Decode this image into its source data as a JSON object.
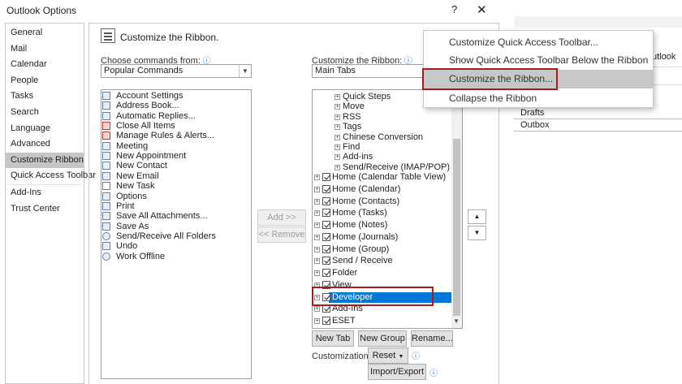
{
  "window": {
    "title": "Outlook Options",
    "help": "?",
    "close": "✕"
  },
  "nav": [
    "General",
    "Mail",
    "Calendar",
    "People",
    "Tasks",
    "Search",
    "Language",
    "Advanced",
    "Customize Ribbon",
    "Quick Access Toolbar",
    "Add-Ins",
    "Trust Center"
  ],
  "header": {
    "title": "Customize the Ribbon."
  },
  "left": {
    "choose_label_pre": "Choose commands from:",
    "combo_value": "Popular Commands",
    "commands": [
      {
        "label": "Account Settings",
        "icon": "account-settings-icon"
      },
      {
        "label": "Address Book...",
        "icon": "address-book-icon"
      },
      {
        "label": "Automatic Replies...",
        "icon": "automatic-replies-icon"
      },
      {
        "label": "Close All Items",
        "icon": "close-items-icon"
      },
      {
        "label": "Manage Rules & Alerts...",
        "icon": "rules-icon"
      },
      {
        "label": "Meeting",
        "icon": "meeting-icon"
      },
      {
        "label": "New Appointment",
        "icon": "calendar-icon"
      },
      {
        "label": "New Contact",
        "icon": "contact-icon"
      },
      {
        "label": "New Email",
        "icon": "mail-icon"
      },
      {
        "label": "New Task",
        "icon": "task-icon"
      },
      {
        "label": "Options",
        "icon": "options-icon"
      },
      {
        "label": "Print",
        "icon": "print-icon"
      },
      {
        "label": "Save All Attachments...",
        "icon": "attachment-icon"
      },
      {
        "label": "Save As",
        "icon": "save-icon"
      },
      {
        "label": "Send/Receive All Folders",
        "icon": "send-receive-icon"
      },
      {
        "label": "Undo",
        "icon": "undo-icon"
      },
      {
        "label": "Work Offline",
        "icon": "offline-icon"
      }
    ]
  },
  "middle": {
    "add": "Add >>",
    "remove": "<< Remove"
  },
  "right": {
    "customize_label": "Customize the Ribbon:",
    "combo_value": "Main Tabs",
    "subgroups": [
      "Quick Steps",
      "Move",
      "RSS",
      "Tags",
      "Chinese Conversion",
      "Find",
      "Add-ins",
      "Send/Receive (IMAP/POP)"
    ],
    "tabs": [
      "Home (Calendar Table View)",
      "Home (Calendar)",
      "Home (Contacts)",
      "Home (Tasks)",
      "Home (Notes)",
      "Home (Journals)",
      "Home (Group)",
      "Send / Receive",
      "Folder",
      "View",
      "Developer",
      "Add-Ins",
      "ESET"
    ],
    "selected_tab": "Developer",
    "new_tab": "New Tab",
    "new_group": "New Group",
    "rename": "Rename...",
    "customizations_label": "Customizations:",
    "reset": "Reset",
    "import_export": "Import/Export"
  },
  "popup": {
    "items": [
      "Customize Quick Access Toolbar...",
      "Show Quick Access Toolbar Below the Ribbon",
      "Customize the Ribbon...",
      "Collapse the Ribbon"
    ],
    "highlighted": "Customize the Ribbon..."
  },
  "background_window": {
    "partial_text": "utlook",
    "folders": [
      "Drafts",
      "Outbox"
    ]
  },
  "colors": {
    "selection": "#0078d7",
    "highlight_box": "#a31e22",
    "nav_active": "#c6c6c6"
  }
}
